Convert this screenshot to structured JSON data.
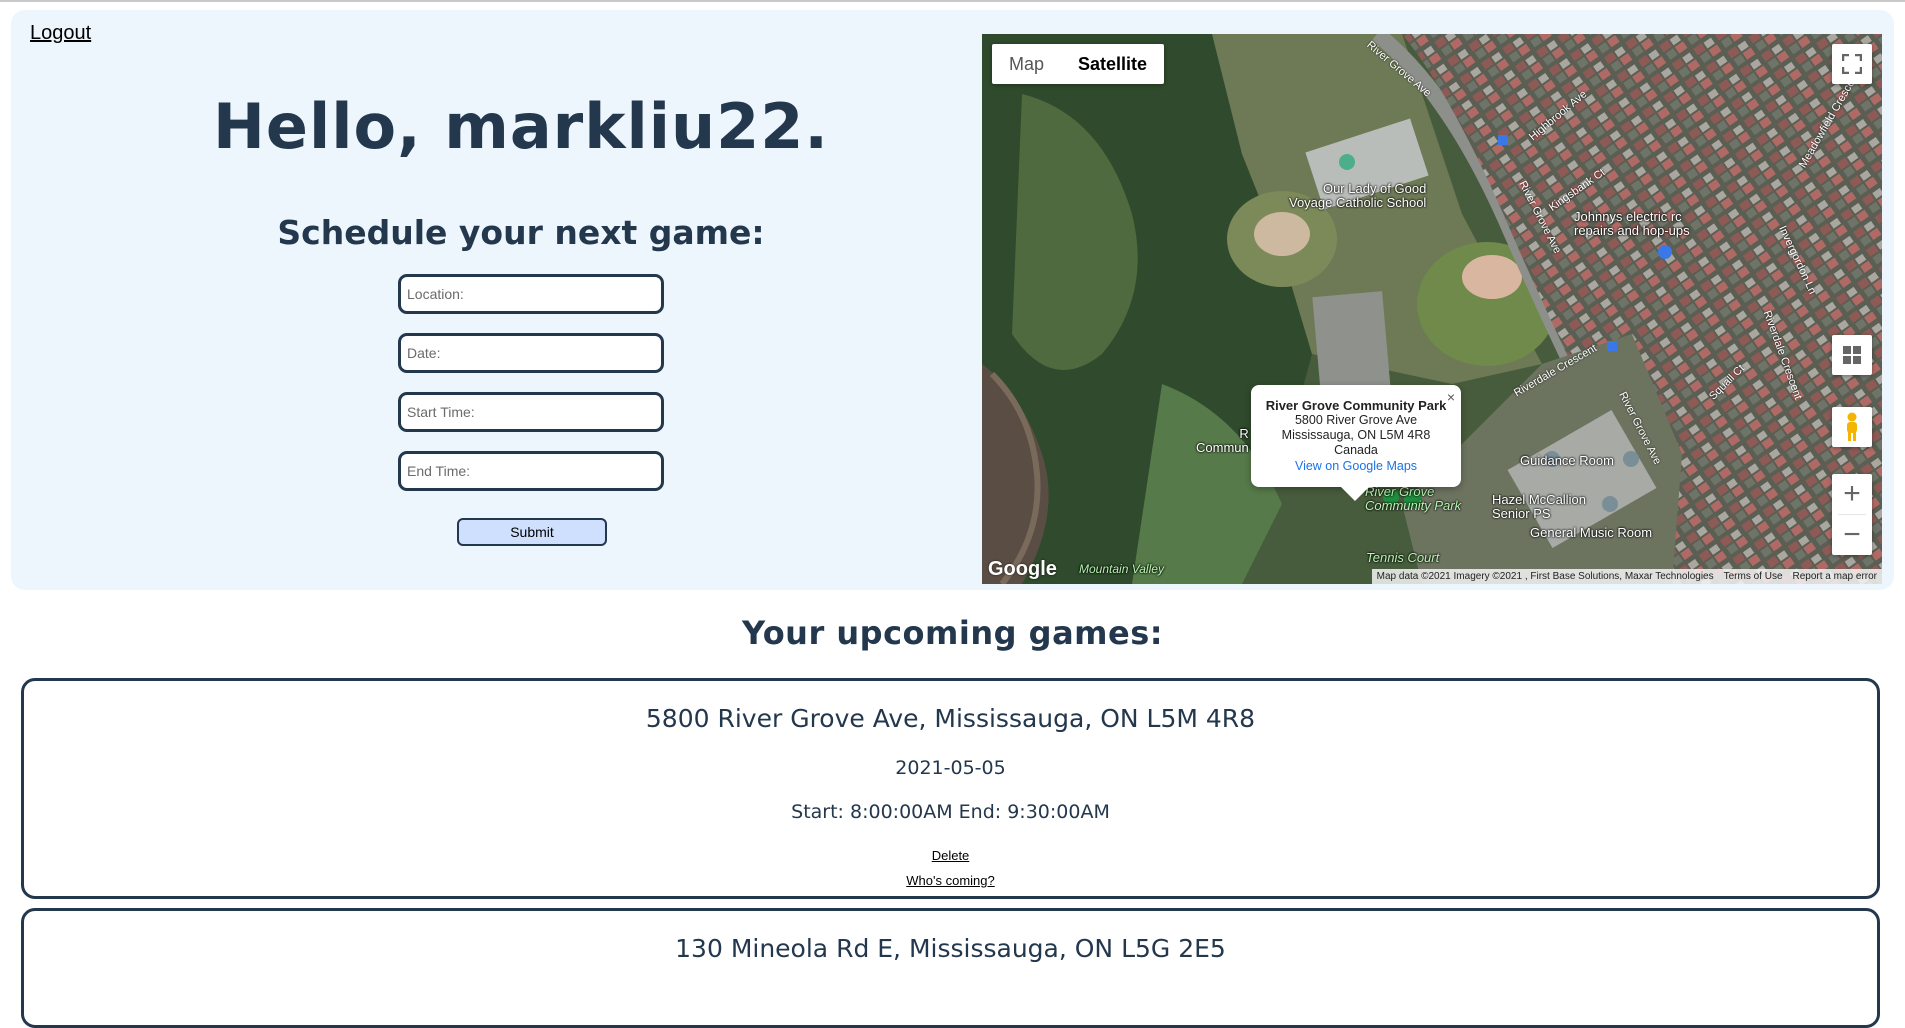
{
  "header": {
    "logout_label": "Logout",
    "greeting": "Hello, markliu22.",
    "schedule_heading": "Schedule your next game:"
  },
  "form": {
    "location_placeholder": "Location:",
    "date_placeholder": "Date:",
    "start_placeholder": "Start Time:",
    "end_placeholder": "End Time:",
    "submit_label": "Submit"
  },
  "map": {
    "type_map_label": "Map",
    "type_satellite_label": "Satellite",
    "selected_type": "Satellite",
    "fullscreen_icon": "fullscreen-icon",
    "layers_icon": "grid-icon",
    "pegman_icon": "pegman-icon",
    "zoom_in_label": "+",
    "zoom_out_label": "−",
    "info_window": {
      "title": "River Grove Community Park",
      "line1": "5800 River Grove Ave",
      "line2": "Mississauga, ON L5M 4R8",
      "line3": "Canada",
      "link": "View on Google Maps",
      "close": "×"
    },
    "footer": {
      "attribution": "Map data ©2021 Imagery ©2021 , First Base Solutions, Maxar Technologies",
      "terms": "Terms of Use",
      "report": "Report a map error"
    },
    "logo": "Google",
    "labels": {
      "school": "Our Lady of Good\nVoyage Catholic School",
      "johnnys": "Johnnys electric rc\nrepairs and hop-ups",
      "guidance": "Guidance Room",
      "hazel": "Hazel McCallion\nSenior PS",
      "music": "General Music Room",
      "park": "River Grove\nCommunity Park",
      "tennis": "Tennis Court",
      "mountain": "Mountain Valley",
      "community_partial": "R\nCommun",
      "river_grove_ave": "River Grove Ave",
      "highbrook": "Highbrook Ave",
      "kingsbank": "Kingsbank Ct",
      "riverdale": "Riverdale Crescent",
      "squall": "Squall Ct",
      "invergordon": "Invergordon Ln",
      "meadowfield": "Meadowfield Crescent",
      "riverdale2": "Riverdale Crescent"
    },
    "colors": {
      "marker_green": "#1e8e3e",
      "info_link": "#1a73e8"
    }
  },
  "upcoming": {
    "heading": "Your upcoming games:",
    "games": [
      {
        "address": "5800 River Grove Ave, Mississauga, ON L5M 4R8",
        "date": "2021-05-05",
        "time": "Start: 8:00:00AM End: 9:30:00AM",
        "delete_label": "Delete",
        "whos_coming_label": "Who's coming?"
      },
      {
        "address": "130 Mineola Rd E, Mississauga, ON L5G 2E5"
      }
    ]
  },
  "colors": {
    "primary_text": "#23374d",
    "panel_bg": "#eef6fd",
    "button_bg": "#cfe0ff"
  }
}
